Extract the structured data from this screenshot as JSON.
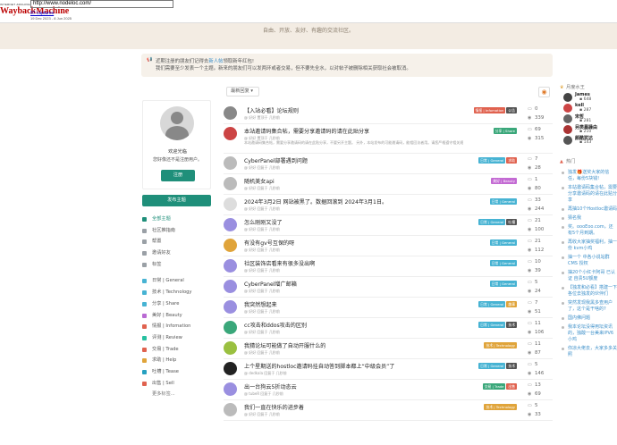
{
  "wayback": {
    "url": "http://www.nodeloc.com/",
    "logo_top": "INTERNET ARCHIVE",
    "logo_main": "WaybackMachine",
    "captures": "87 captures",
    "range": "19 Dec 2023 - 8 Jun 2025"
  },
  "banner": {
    "slogan": "自由、开放、友好、有趣的交流社区。"
  },
  "notice": {
    "line1_prefix": "近期注册的朋友们记得去",
    "line1_link": "新人帖",
    "line1_suffix": "领取新年红包!",
    "line2": "我们需要至少发表一个主题。新来的朋友们可以发两环或者交易，但不要先全水，以对帖子被删除相关获取社会被取消。"
  },
  "sort": {
    "label": "最新回复"
  },
  "profile": {
    "welcome": "欢迎光临",
    "tip": "您好像还不是注册用户。",
    "register": "注册"
  },
  "new_topic": "发布主题",
  "nav": {
    "main": [
      {
        "label": "全部主题",
        "color": "#1f8f7a"
      },
      {
        "label": "社区推指南",
        "color": "#9aa0a6"
      },
      {
        "label": "帮置",
        "color": "#9aa0a6"
      },
      {
        "label": "邀请好友",
        "color": "#9aa0a6"
      },
      {
        "label": "标签",
        "color": "#9aa0a6"
      }
    ],
    "tags": [
      {
        "label": "日常 | General",
        "color": "#47b3d3"
      },
      {
        "label": "技术 | Technology",
        "color": "#47b3d3"
      },
      {
        "label": "分享 | Share",
        "color": "#47b3d3"
      },
      {
        "label": "美好 | Beauty",
        "color": "#b96ad3"
      },
      {
        "label": "情报 | Infomation",
        "color": "#e0624f"
      },
      {
        "label": "评测 | Review",
        "color": "#26c0a0"
      },
      {
        "label": "交易 | Trade",
        "color": "#e0624f"
      },
      {
        "label": "求助 | Help",
        "color": "#e0a43a"
      },
      {
        "label": "吐槽 | Tease",
        "color": "#26a0c0"
      },
      {
        "label": "出售 | Sell",
        "color": "#e0624f"
      }
    ],
    "more": "更多标签..."
  },
  "topics": [
    {
      "title": "【入站必看】论坛规则",
      "meta": "@ 好好 置顶于 几秒前",
      "tags": [
        {
          "t": "情报 | Infomation",
          "c": "#e0624f"
        },
        {
          "t": "公告",
          "c": "#555"
        }
      ],
      "replies": "0",
      "views": "339",
      "av": "#888"
    },
    {
      "title": "本站邀请码集合帖，需要分享邀请码的请在此贴分享",
      "meta": "@ 好好 置顶于 几秒前",
      "excerpt": "本站邀请码集合帖，需要分享邀请码的请在此贴分享，不要另开主题。 另外，本站发布的可能邀请码，能相回访者用。请您严格遵守相关规定，不要重做删除。",
      "tags": [
        {
          "t": "分享 | Share",
          "c": "#3aa77a"
        }
      ],
      "replies": "69",
      "views": "315",
      "av": "#c44"
    },
    {
      "title": "CyberPanel部署遇到问题",
      "meta": "@ 好好 回复于 几秒前",
      "tags": [
        {
          "t": "日常 | General",
          "c": "#47b3d3"
        },
        {
          "t": "求助",
          "c": "#e0624f"
        }
      ],
      "replies": "7",
      "views": "28",
      "av": "#bbb"
    },
    {
      "title": "随机美女api",
      "meta": "@ 好好 回复于 几秒前",
      "tags": [
        {
          "t": "美好 | Beauty",
          "c": "#c36ad3"
        }
      ],
      "replies": "1",
      "views": "80",
      "av": "#bbb"
    },
    {
      "title": "2024年3月2日 网站被黑了。数据回滚到 2024年3月1日。",
      "meta": "@ 好好 回复于 几秒前",
      "tags": [
        {
          "t": "日常 | General",
          "c": "#47b3d3"
        }
      ],
      "replies": "33",
      "views": "244",
      "av": "#ddd"
    },
    {
      "title": "怎么刚刚又没了",
      "meta": "@ 好好 回复于 几秒前",
      "tags": [
        {
          "t": "日常 | General",
          "c": "#47b3d3"
        },
        {
          "t": "吐槽",
          "c": "#555"
        }
      ],
      "replies": "21",
      "views": "100",
      "av": "#9a8fe0"
    },
    {
      "title": "有没有gv号互保的呀",
      "meta": "@ 好好 回复于 几秒前",
      "tags": [
        {
          "t": "日常 | General",
          "c": "#47b3d3"
        }
      ],
      "replies": "21",
      "views": "112",
      "av": "#e0a43a"
    },
    {
      "title": "社区装饰店看来有很多没出啊",
      "meta": "@ 好好 回复于 几秒前",
      "tags": [
        {
          "t": "日常 | General",
          "c": "#47b3d3"
        }
      ],
      "replies": "10",
      "views": "39",
      "av": "#9a8fe0"
    },
    {
      "title": "CyberPanel增广邮箱",
      "meta": "@ 好好 回复于 几秒前",
      "tags": [
        {
          "t": "日常 | General",
          "c": "#47b3d3"
        }
      ],
      "replies": "5",
      "views": "24",
      "av": "#9a8fe0"
    },
    {
      "title": "我突然想起来",
      "meta": "@ 好好 回复于 几秒前",
      "tags": [
        {
          "t": "日常 | General",
          "c": "#47b3d3"
        },
        {
          "t": "趣事",
          "c": "#e0a43a"
        }
      ],
      "replies": "7",
      "views": "51",
      "av": "#9a8fe0"
    },
    {
      "title": "cc攻击和ddos攻击的区别",
      "meta": "@ 好好 回复于 几秒前",
      "tags": [
        {
          "t": "日常 | General",
          "c": "#47b3d3"
        },
        {
          "t": "技术",
          "c": "#555"
        }
      ],
      "replies": "11",
      "views": "106",
      "av": "#3aa77a"
    },
    {
      "title": "我猜论坛可能做了自动开服什么的",
      "meta": "@ 好好 回复于 几秒前",
      "tags": [
        {
          "t": "技术 | Technology",
          "c": "#e0a43a"
        }
      ],
      "replies": "11",
      "views": "87",
      "av": "#9ac040"
    },
    {
      "title": "上个星期送的hostloc邀请码挂自动答到脚本都上“中级会员”了",
      "meta": "@ dedkala 回复于 几秒前",
      "tags": [
        {
          "t": "日常 | General",
          "c": "#47b3d3"
        },
        {
          "t": "技术",
          "c": "#555"
        }
      ],
      "replies": "5",
      "views": "146",
      "av": "#222"
    },
    {
      "title": "出一台狗云5折动态云",
      "meta": "@ tubeR 回复于 几秒前",
      "tags": [
        {
          "t": "交易 | Trade",
          "c": "#3aa77a"
        },
        {
          "t": "出售",
          "c": "#e0624f"
        }
      ],
      "replies": "13",
      "views": "69",
      "av": "#9a8fe0"
    },
    {
      "title": "我们一直在快乐的进步着",
      "meta": "@ 好好 回复于 几秒前",
      "tags": [
        {
          "t": "技术 | Technology",
          "c": "#e0a43a"
        }
      ],
      "replies": "5",
      "views": "33",
      "av": "#bbb"
    }
  ],
  "ranking": {
    "heading": "月度水王",
    "users": [
      {
        "name": "James",
        "score": "648",
        "av": "#444"
      },
      {
        "name": "kell",
        "score": "287",
        "av": "#c44"
      },
      {
        "name": "宋哲",
        "score": "281",
        "av": "#666"
      },
      {
        "name": "另类暴躁由",
        "score": "210",
        "av": "#a33"
      },
      {
        "name": "颜酷犹达",
        "score": "143",
        "av": "#555"
      }
    ]
  },
  "hot": {
    "heading": "热门",
    "items": [
      "独发🎁送奖大家的信任，每份5块钱!",
      "本站邀请码集合帖，需要分享邀请码的请在此贴分享",
      "再抽10个Hostloc邀请码",
      "猜名我",
      "奖。oooEoo.com，还有5个月到期。",
      "再收大家抽奖福利，抽一份 kvm小鸡",
      "抽一个 中各小说站群 CMS 授权",
      "抽20个小红卡阿哥 已认证 自贵5U额度",
      "【独发和必看】搭建一下各位去独发的伙伴们",
      "突然发现我黑多查用户了，这个是干啥的?",
      "国内佛问题",
      "我本论坛没得用坛资讯的，独酸一台美来IPV6小鸡",
      "你凉大佬去，大家多多关照"
    ]
  }
}
